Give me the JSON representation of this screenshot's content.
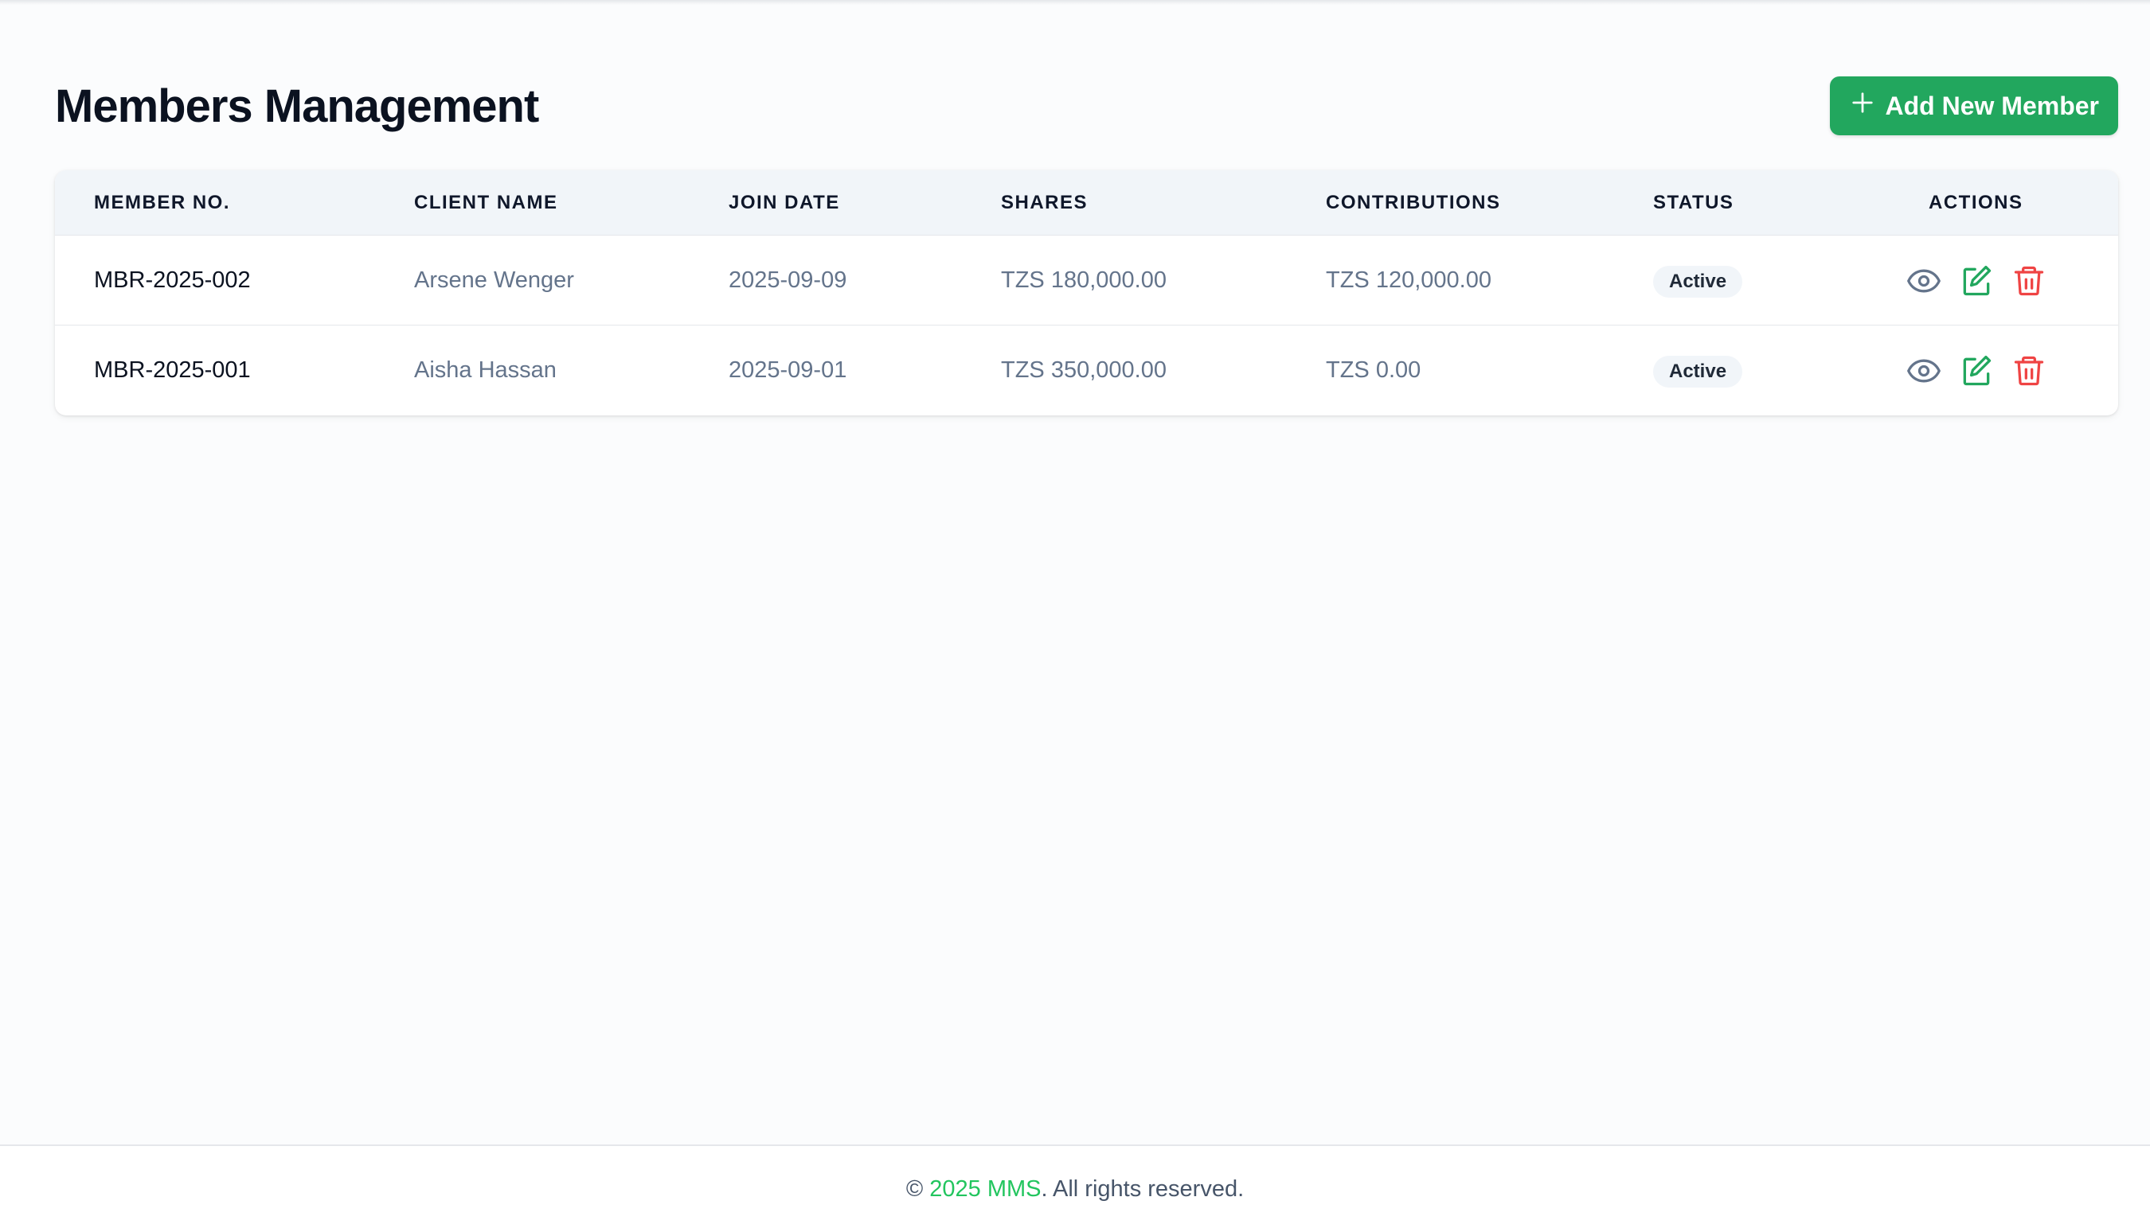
{
  "page": {
    "title": "Members Management",
    "add_button_label": "Add New Member"
  },
  "table": {
    "columns": {
      "member_no": "Member No.",
      "client_name": "Client Name",
      "join_date": "Join Date",
      "shares": "Shares",
      "contributions": "Contributions",
      "status": "Status",
      "actions": "Actions"
    },
    "rows": [
      {
        "member_no": "MBR-2025-002",
        "client_name": "Arsene Wenger",
        "join_date": "2025-09-09",
        "shares": "TZS 180,000.00",
        "contributions": "TZS 120,000.00",
        "status": "Active"
      },
      {
        "member_no": "MBR-2025-001",
        "client_name": "Aisha Hassan",
        "join_date": "2025-09-01",
        "shares": "TZS 350,000.00",
        "contributions": "TZS 0.00",
        "status": "Active"
      }
    ],
    "action_icons": [
      "view-icon",
      "edit-icon",
      "delete-icon"
    ]
  },
  "footer": {
    "copyright_symbol": "©",
    "brand": "2025 MMS",
    "suffix": ". All rights reserved."
  },
  "colors": {
    "accent": "#22a75e",
    "brand_text": "#22c55e",
    "delete": "#ef4444",
    "view": "#64748b"
  }
}
